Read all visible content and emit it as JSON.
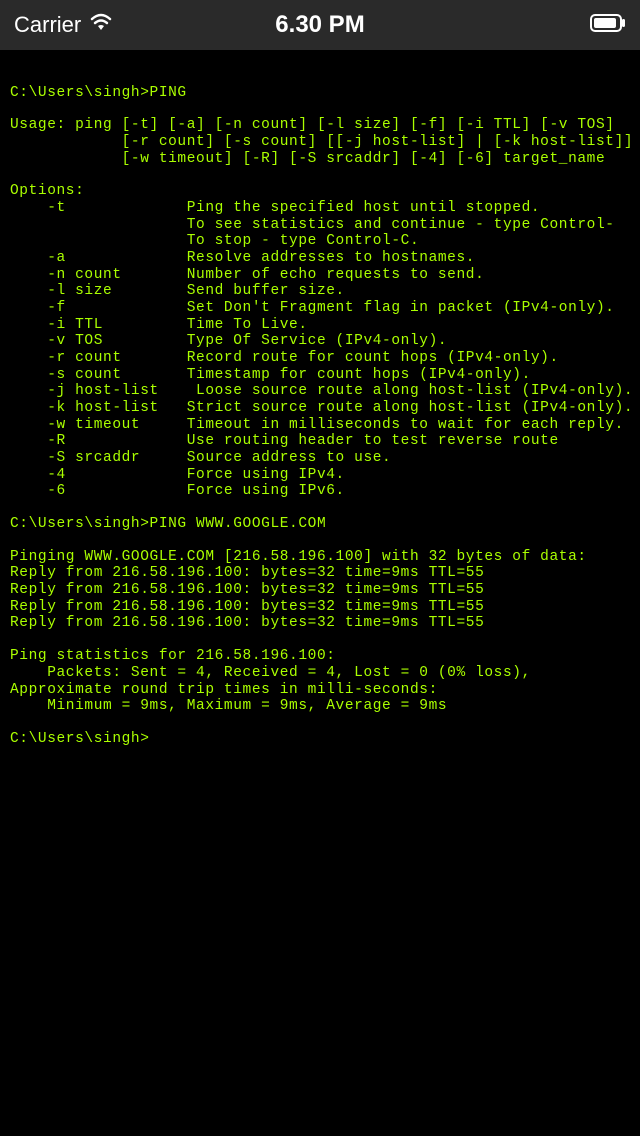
{
  "status_bar": {
    "carrier": "Carrier",
    "time": "6.30 PM"
  },
  "terminal": {
    "lines": [
      "C:\\Users\\singh>PING",
      "",
      "Usage: ping [-t] [-a] [-n count] [-l size] [-f] [-i TTL] [-v TOS]",
      "            [-r count] [-s count] [[-j host-list] | [-k host-list]]",
      "            [-w timeout] [-R] [-S srcaddr] [-4] [-6] target_name",
      "",
      "Options:",
      "    -t             Ping the specified host until stopped.",
      "                   To see statistics and continue - type Control-",
      "                   To stop - type Control-C.",
      "    -a             Resolve addresses to hostnames.",
      "    -n count       Number of echo requests to send.",
      "    -l size        Send buffer size.",
      "    -f             Set Don't Fragment flag in packet (IPv4-only).",
      "    -i TTL         Time To Live.",
      "    -v TOS         Type Of Service (IPv4-only).",
      "    -r count       Record route for count hops (IPv4-only).",
      "    -s count       Timestamp for count hops (IPv4-only).",
      "    -j host-list    Loose source route along host-list (IPv4-only).",
      "    -k host-list   Strict source route along host-list (IPv4-only).",
      "    -w timeout     Timeout in milliseconds to wait for each reply.",
      "    -R             Use routing header to test reverse route",
      "    -S srcaddr     Source address to use.",
      "    -4             Force using IPv4.",
      "    -6             Force using IPv6.",
      "",
      "C:\\Users\\singh>PING WWW.GOOGLE.COM",
      "",
      "Pinging WWW.GOOGLE.COM [216.58.196.100] with 32 bytes of data:",
      "Reply from 216.58.196.100: bytes=32 time=9ms TTL=55",
      "Reply from 216.58.196.100: bytes=32 time=9ms TTL=55",
      "Reply from 216.58.196.100: bytes=32 time=9ms TTL=55",
      "Reply from 216.58.196.100: bytes=32 time=9ms TTL=55",
      "",
      "Ping statistics for 216.58.196.100:",
      "    Packets: Sent = 4, Received = 4, Lost = 0 (0% loss),",
      "Approximate round trip times in milli-seconds:",
      "    Minimum = 9ms, Maximum = 9ms, Average = 9ms",
      "",
      "C:\\Users\\singh>"
    ]
  }
}
